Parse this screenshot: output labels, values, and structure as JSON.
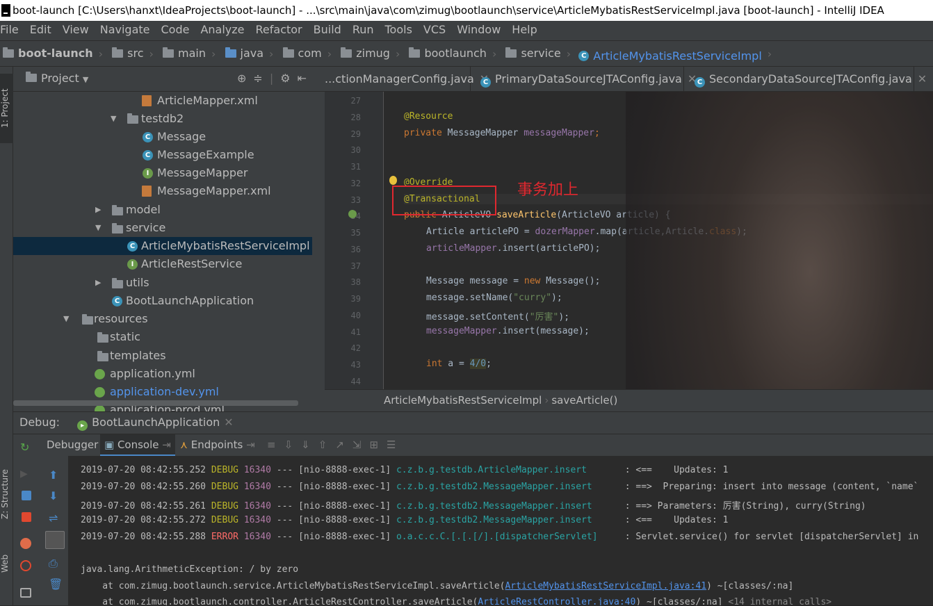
{
  "title": "boot-launch [C:\\Users\\hanxt\\IdeaProjects\\boot-launch] - ...\\src\\main\\java\\com\\zimug\\bootlaunch\\service\\ArticleMybatisRestServiceImpl.java [boot-launch] - IntelliJ IDEA",
  "menu": [
    "File",
    "Edit",
    "View",
    "Navigate",
    "Code",
    "Analyze",
    "Refactor",
    "Build",
    "Run",
    "Tools",
    "VCS",
    "Window",
    "Help"
  ],
  "breadcrumbs": [
    "boot-launch",
    "src",
    "main",
    "java",
    "com",
    "zimug",
    "bootlaunch",
    "service",
    "ArticleMybatisRestServiceImpl"
  ],
  "project": {
    "title": "Project",
    "tree": [
      "ArticleMapper.xml",
      "testdb2",
      "Message",
      "MessageExample",
      "MessageMapper",
      "MessageMapper.xml",
      "model",
      "service",
      "ArticleMybatisRestServiceImpl",
      "ArticleRestService",
      "utils",
      "BootLaunchApplication",
      "resources",
      "static",
      "templates",
      "application.yml",
      "application-dev.yml",
      "application-prod.yml"
    ]
  },
  "left_strip": {
    "project_tab": "1: Project",
    "structure_tab": "Z: Structure",
    "web_tab": "Web"
  },
  "tabs": [
    "...ctionManagerConfig.java",
    "PrimaryDataSourceJTAConfig.java",
    "SecondaryDataSourceJTAConfig.java"
  ],
  "line_numbers": [
    "27",
    "28",
    "29",
    "30",
    "31",
    "32",
    "33",
    "34",
    "35",
    "36",
    "37",
    "38",
    "39",
    "40",
    "41",
    "42",
    "43",
    "44"
  ],
  "code": {
    "l28": "@Resource",
    "l29_kw": "private",
    "l29_type": " MessageMapper ",
    "l29_fld": "messageMapper",
    "l29_end": ";",
    "l32": "@Override",
    "l33": "@Transactional",
    "l34_kw": "public",
    "l34_a": " ArticleVO ",
    "l34_m": "saveArticle",
    "l34_b": "(ArticleVO article) {",
    "l35_a": "Article articlePO = ",
    "l35_f": "dozerMapper",
    "l35_b": ".map(article,Article.",
    "l35_k": "class",
    "l35_e": ");",
    "l36_f": "articleMapper",
    "l36_b": ".insert(articlePO);",
    "l38_a": "Message message = ",
    "l38_k": "new",
    "l38_b": " Message();",
    "l39_a": "message.setName(",
    "l39_s": "\"curry\"",
    "l39_e": ");",
    "l40_a": "message.setContent(",
    "l40_s": "\"厉害\"",
    "l40_e": ");",
    "l41_f": "messageMapper",
    "l41_b": ".insert(message);",
    "l43_k": "int",
    "l43_a": " a = ",
    "l43_n": "4/0",
    "l43_e": ";"
  },
  "annotation_note": "事务加上",
  "editor_breadcrumb": {
    "class": "ArticleMybatisRestServiceImpl",
    "method": "saveArticle()"
  },
  "debug": {
    "label": "Debug:",
    "config": "BootLaunchApplication",
    "tabs": {
      "debugger": "Debugger",
      "console": "Console",
      "endpoints": "Endpoints"
    }
  },
  "console_lines": [
    {
      "ts": "2019-07-20 08:42:55.252",
      "lvl": "DEBUG",
      "pid": "16340",
      "sep": "---",
      "thr": "[nio-8888-exec-1]",
      "logger": "c.z.b.g.testdb.ArticleMapper.insert      ",
      "msg": ": <==    Updates: 1"
    },
    {
      "ts": "2019-07-20 08:42:55.260",
      "lvl": "DEBUG",
      "pid": "16340",
      "sep": "---",
      "thr": "[nio-8888-exec-1]",
      "logger": "c.z.b.g.testdb2.MessageMapper.insert     ",
      "msg": ": ==>  Preparing: insert into message (content, `name`"
    },
    {
      "ts": "2019-07-20 08:42:55.261",
      "lvl": "DEBUG",
      "pid": "16340",
      "sep": "---",
      "thr": "[nio-8888-exec-1]",
      "logger": "c.z.b.g.testdb2.MessageMapper.insert     ",
      "msg": ": ==> Parameters: 厉害(String), curry(String)"
    },
    {
      "ts": "2019-07-20 08:42:55.272",
      "lvl": "DEBUG",
      "pid": "16340",
      "sep": "---",
      "thr": "[nio-8888-exec-1]",
      "logger": "c.z.b.g.testdb2.MessageMapper.insert     ",
      "msg": ": <==    Updates: 1"
    },
    {
      "ts": "2019-07-20 08:42:55.288",
      "lvl": "ERROR",
      "pid": "16340",
      "sep": "---",
      "thr": "[nio-8888-exec-1]",
      "logger": "o.a.c.c.C.[.[.[/].[dispatcherServlet]    ",
      "msg": ": Servlet.service() for servlet [dispatcherServlet] in"
    }
  ],
  "exception": "java.lang.ArithmeticException: / by zero",
  "stack1": {
    "pre": "    at com.zimug.bootlaunch.service.ArticleMybatisRestServiceImpl.saveArticle(",
    "link": "ArticleMybatisRestServiceImpl.java:41",
    "post": ") ~[classes/:na]"
  },
  "stack2": {
    "pre": "    at com.zimug.bootlaunch.controller.ArticleRestController.saveArticle(",
    "link": "ArticleRestController.java:40",
    "post": ") ~[classes/:na] ",
    "ghost": "<14 internal calls>"
  }
}
